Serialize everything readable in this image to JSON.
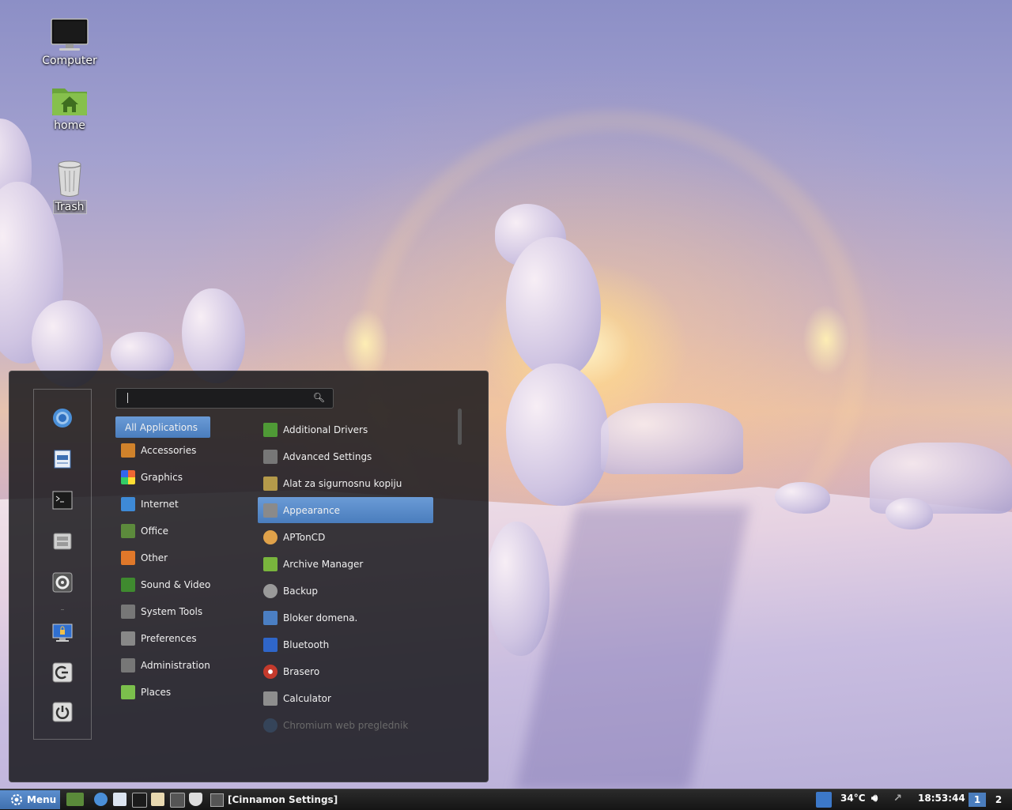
{
  "desktop": {
    "icons": [
      {
        "label": "Computer"
      },
      {
        "label": "home"
      },
      {
        "label": "Trash"
      }
    ]
  },
  "menu": {
    "search": {
      "value": "",
      "placeholder": ""
    },
    "favorites": [
      {
        "icon": "chromium-icon"
      },
      {
        "icon": "document-viewer-icon"
      },
      {
        "icon": "terminal-icon"
      },
      {
        "icon": "files-icon"
      },
      {
        "icon": "settings-icon"
      },
      {
        "icon": "lock-screen-icon"
      },
      {
        "icon": "logout-icon"
      },
      {
        "icon": "power-icon"
      }
    ],
    "categories": [
      {
        "label": "All Applications",
        "active": true
      },
      {
        "label": "Accessories",
        "color": "#d0822b"
      },
      {
        "label": "Graphics",
        "color": "#c74bd1"
      },
      {
        "label": "Internet",
        "color": "#3e8ad6"
      },
      {
        "label": "Office",
        "color": "#5c8a3c"
      },
      {
        "label": "Other",
        "color": "#e0782a"
      },
      {
        "label": "Sound & Video",
        "color": "#3f8a2f"
      },
      {
        "label": "System Tools",
        "color": "#777777"
      },
      {
        "label": "Preferences",
        "color": "#888888"
      },
      {
        "label": "Administration",
        "color": "#777777"
      },
      {
        "label": "Places",
        "color": "#7bbf4c"
      }
    ],
    "apps": [
      {
        "label": "Additional Drivers",
        "color": "#4f9a36"
      },
      {
        "label": "Advanced Settings",
        "color": "#777777"
      },
      {
        "label": "Alat za sigurnosnu kopiju",
        "color": "#b59a4a"
      },
      {
        "label": "Appearance",
        "color": "#8a8a8a",
        "active": true
      },
      {
        "label": "APTonCD",
        "color": "#e0a24a"
      },
      {
        "label": "Archive Manager",
        "color": "#79b53d"
      },
      {
        "label": "Backup",
        "color": "#9a9a9a"
      },
      {
        "label": "Bloker domena.",
        "color": "#4b7fc3"
      },
      {
        "label": "Bluetooth",
        "color": "#2f66c9"
      },
      {
        "label": "Brasero",
        "color": "#c43a2c"
      },
      {
        "label": "Calculator",
        "color": "#8e8e8e"
      },
      {
        "label": "Chromium web preglednik",
        "color": "#3a5a7a",
        "faded": true
      }
    ]
  },
  "panel": {
    "menu_label": "Menu",
    "window_title": "[Cinnamon Settings]",
    "temperature": "34°C",
    "clock": "18:53:44",
    "workspaces": [
      "1",
      "2"
    ]
  }
}
